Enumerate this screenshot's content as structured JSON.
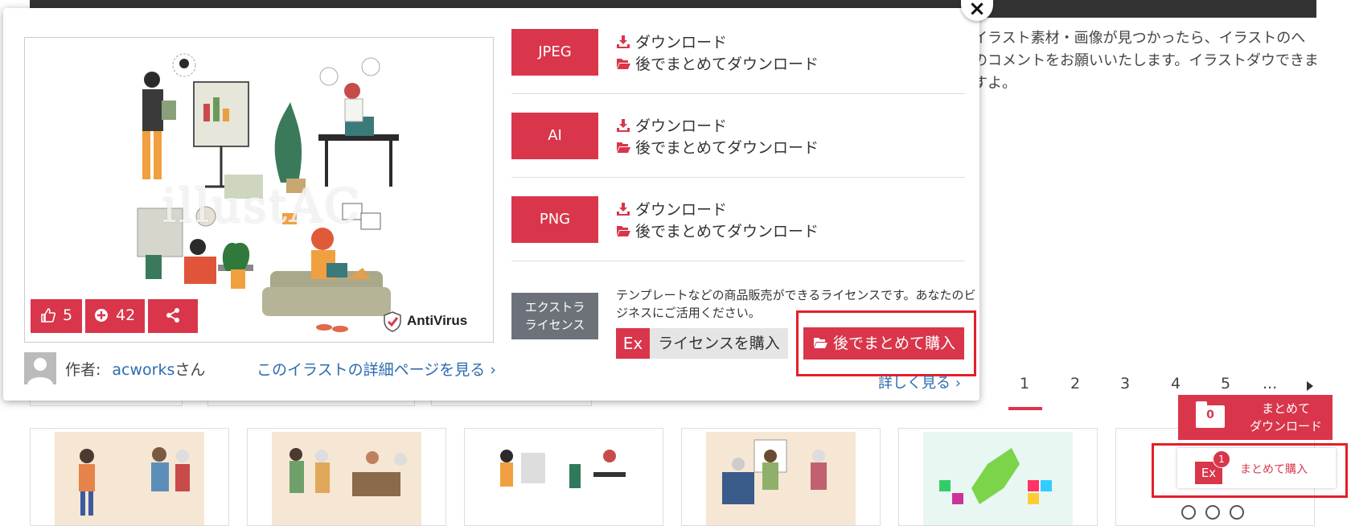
{
  "background": {
    "description_text": "イラスト素材・画像が見つかったら、イラストのへのコメントをお願いいたします。イラストダウできますよ。",
    "pagination": [
      "1",
      "2",
      "3",
      "4",
      "5",
      "..."
    ],
    "active_page": "1"
  },
  "floating": {
    "bulk_download": {
      "count": "0",
      "label": "まとめて\nダウンロード"
    },
    "bulk_buy": {
      "ex": "Ex",
      "badge": "1",
      "label": "まとめて購入"
    }
  },
  "modal": {
    "close": "×",
    "stats": {
      "likes": "5",
      "adds": "42"
    },
    "watermark": "illustAC",
    "antivirus": "AntiVirus",
    "author_label": "作者:",
    "author_name": "acworks",
    "author_suffix": "さん",
    "detail_link": "このイラストの詳細ページを見る ›",
    "formats": [
      {
        "label": "JPEG",
        "download": "ダウンロード",
        "later": "後でまとめてダウンロード"
      },
      {
        "label": "AI",
        "download": "ダウンロード",
        "later": "後でまとめてダウンロード"
      },
      {
        "label": "PNG",
        "download": "ダウンロード",
        "later": "後でまとめてダウンロード"
      }
    ],
    "extra_license": {
      "label": "エクストラ\nライセンス",
      "description": "テンプレートなどの商品販売ができるライセンスです。あなたのビジネスにご活用ください。",
      "ex": "Ex",
      "buy": "ライセンスを購入",
      "later_buy": "後でまとめて購入",
      "more": "詳しく見る ›"
    }
  },
  "colors": {
    "accent": "#d9364b",
    "highlight_frame": "#e3202a",
    "link": "#2b6cb0"
  }
}
